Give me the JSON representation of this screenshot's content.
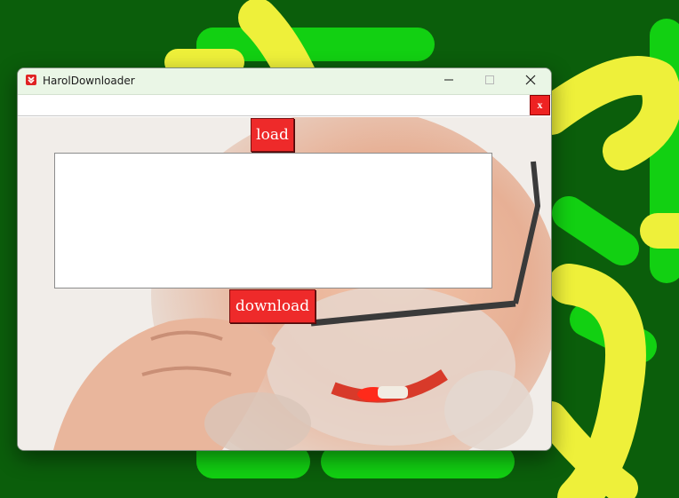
{
  "window": {
    "title": "HarolDownloader"
  },
  "titlebar_buttons": {
    "minimize_icon": "minimize-icon",
    "maximize_icon": "maximize-icon",
    "close_icon": "close-icon"
  },
  "toolbar": {
    "url_value": "",
    "clear_label": "x"
  },
  "main": {
    "load_label": "load",
    "textarea_value": "",
    "download_label": "download"
  },
  "colors": {
    "desktop_bg": "#0b5e0b",
    "desktop_accent_green": "#12d012",
    "desktop_accent_yellow": "#eef03a",
    "button_red": "#ee2a2a",
    "titlebar_bg": "#eaf6e6"
  }
}
